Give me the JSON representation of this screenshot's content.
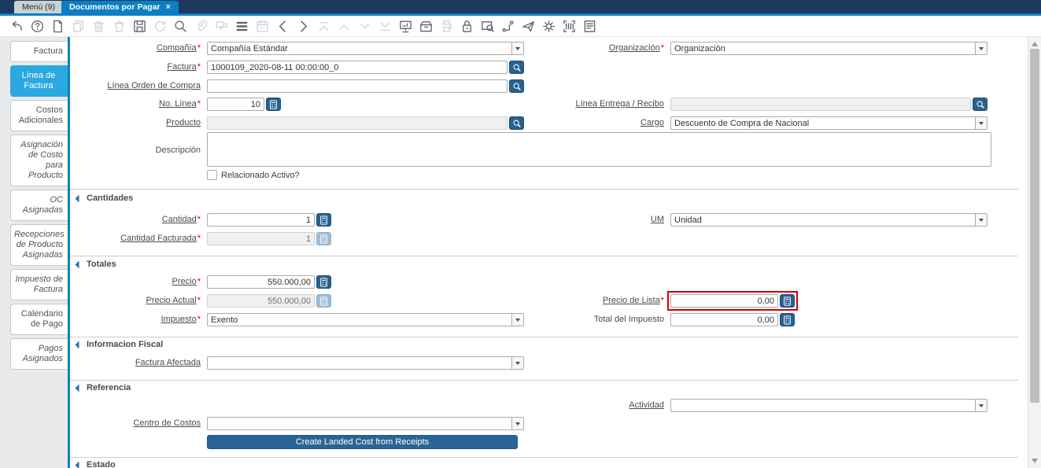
{
  "window": {
    "nav_tabs": [
      {
        "label": "Menú (9)"
      },
      {
        "label": "Documentos por Pagar"
      }
    ],
    "close_glyph": "×"
  },
  "toolbar": {
    "icons": [
      {
        "name": "undo",
        "enabled": true
      },
      {
        "name": "help",
        "enabled": true
      },
      {
        "name": "new-record",
        "enabled": true
      },
      {
        "name": "copy-record",
        "enabled": false
      },
      {
        "name": "delete-record",
        "enabled": false
      },
      {
        "name": "delete-selection",
        "enabled": false
      },
      {
        "name": "save",
        "enabled": true
      },
      {
        "name": "refresh",
        "enabled": false
      },
      {
        "name": "find",
        "enabled": true
      },
      {
        "name": "attachment",
        "enabled": false
      },
      {
        "name": "chat",
        "enabled": false
      },
      {
        "name": "grid-toggle",
        "enabled": true
      },
      {
        "name": "calendar",
        "enabled": false
      },
      {
        "name": "parent-record",
        "enabled": true
      },
      {
        "name": "detail-record",
        "enabled": true
      },
      {
        "name": "first-record",
        "enabled": false
      },
      {
        "name": "previous-record",
        "enabled": false
      },
      {
        "name": "next-record",
        "enabled": false
      },
      {
        "name": "last-record",
        "enabled": false
      },
      {
        "name": "report",
        "enabled": true
      },
      {
        "name": "archive",
        "enabled": true
      },
      {
        "name": "print",
        "enabled": false
      },
      {
        "name": "lock",
        "enabled": true
      },
      {
        "name": "zoom-across",
        "enabled": true
      },
      {
        "name": "workflow",
        "enabled": true
      },
      {
        "name": "send-mail",
        "enabled": true
      },
      {
        "name": "preferences",
        "enabled": true
      },
      {
        "name": "product-info",
        "enabled": true
      },
      {
        "name": "print-preview",
        "enabled": true
      }
    ]
  },
  "sidebar": {
    "tabs": [
      {
        "label": "Factura",
        "active": false,
        "readonly": false
      },
      {
        "label": "Línea de Factura",
        "active": true,
        "readonly": false
      },
      {
        "label": "Costos Adicionales",
        "active": false,
        "readonly": false
      },
      {
        "label": "Asignación de Costo para Producto",
        "active": false,
        "readonly": true
      },
      {
        "label": "OC Asignadas",
        "active": false,
        "readonly": true
      },
      {
        "label": "Recepciones de Producto Asignadas",
        "active": false,
        "readonly": true
      },
      {
        "label": "Impuesto de Factura",
        "active": false,
        "readonly": true
      },
      {
        "label": "Calendario de Pago",
        "active": false,
        "readonly": false
      },
      {
        "label": "Pagos Asignados",
        "active": false,
        "readonly": true
      }
    ]
  },
  "form": {
    "required_marker": "*",
    "fields": {
      "compania": {
        "label": "Compañía",
        "value": "Compañía Estándar",
        "required": true
      },
      "organizacion": {
        "label": "Organización",
        "value": "Organización",
        "required": true
      },
      "factura": {
        "label": "Factura",
        "value": "1000109_2020-08-11 00:00:00_0",
        "required": true
      },
      "linea_orden_compra": {
        "label": "Línea Orden de Compra",
        "value": ""
      },
      "no_linea": {
        "label": "No. Línea",
        "value": "10",
        "required": true
      },
      "linea_entrega_recibo": {
        "label": "Línea Entrega / Recibo",
        "value": "",
        "disabled": true
      },
      "producto": {
        "label": "Producto",
        "value": "",
        "disabled": true
      },
      "cargo": {
        "label": "Cargo",
        "value": "Descuento de Compra de Nacional"
      },
      "descripcion": {
        "label": "Descripción",
        "value": ""
      },
      "relacionado_activo": {
        "label": "Relacionado Activo?",
        "checked": false
      },
      "cantidad": {
        "label": "Cantidad",
        "value": "1",
        "required": true
      },
      "um": {
        "label": "UM",
        "value": "Unidad"
      },
      "cantidad_facturada": {
        "label": "Cantidad Facturada",
        "value": "1",
        "required": true,
        "disabled": true
      },
      "precio": {
        "label": "Precio",
        "value": "550.000,00",
        "required": true
      },
      "precio_actual": {
        "label": "Precio Actual",
        "value": "550.000,00",
        "required": true,
        "disabled": true
      },
      "precio_de_lista": {
        "label": "Precio de Lista",
        "value": "0,00",
        "required": true,
        "highlighted": true
      },
      "impuesto": {
        "label": "Impuesto",
        "value": "Exento",
        "required": true
      },
      "total_del_impuesto": {
        "label": "Total del Impuesto",
        "value": "0,00"
      },
      "factura_afectada": {
        "label": "Factura Afectada",
        "value": ""
      },
      "actividad": {
        "label": "Actividad",
        "value": ""
      },
      "centro_de_costos": {
        "label": "Centro de Costos",
        "value": ""
      }
    },
    "sections": {
      "cantidades": "Cantidades",
      "totales": "Totales",
      "informacion_fiscal": "Informacion Fiscal",
      "referencia": "Referencia",
      "estado": "Estado"
    },
    "buttons": {
      "create_landed_cost": "Create Landed Cost from Receipts"
    }
  },
  "colors": {
    "topbar_bg": "#1c3a5e",
    "active_tab_blue": "#0d7ec4",
    "sidebar_active_tab": "#2aa9e0",
    "action_button_blue": "#27618f",
    "highlight_red": "#d40000",
    "required_red": "#d40000"
  }
}
